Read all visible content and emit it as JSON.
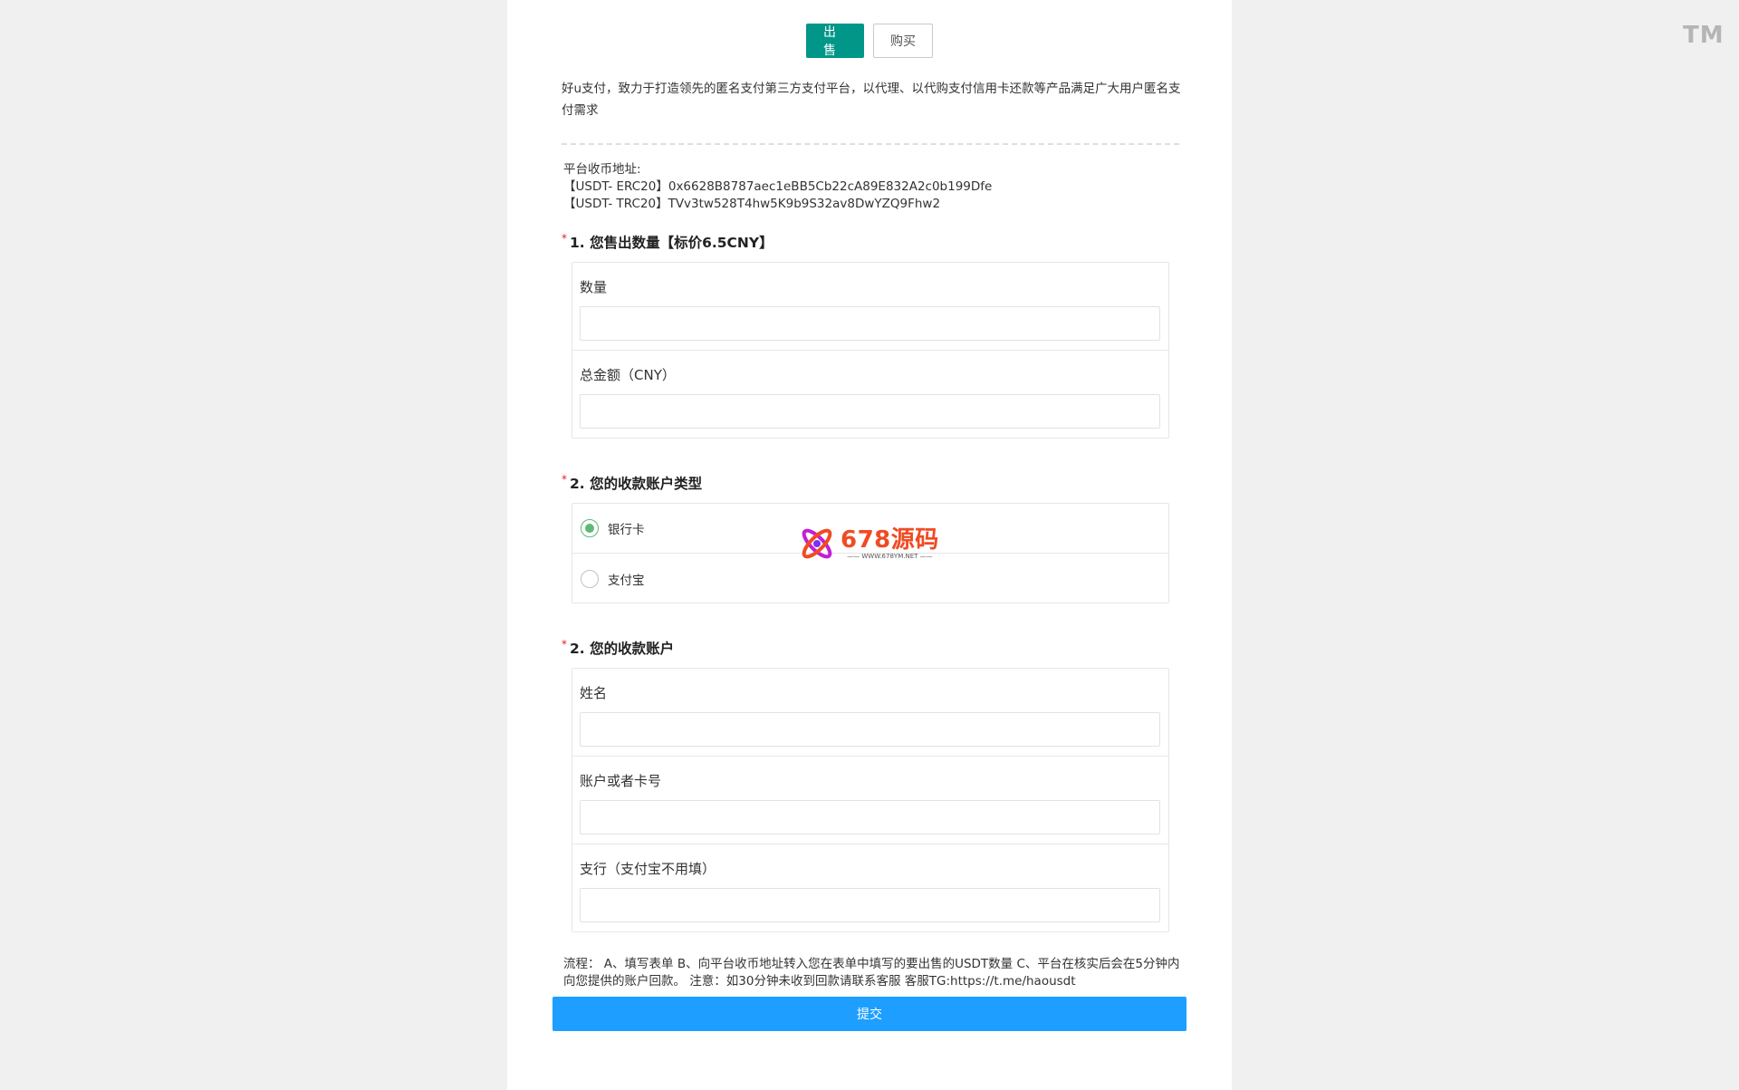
{
  "corner_mark": "TM",
  "tabs": {
    "sell_label": "出售",
    "buy_label": "购买"
  },
  "intro_text": "好u支付，致力于打造领先的匿名支付第三方支付平台，以代理、以代购支付信用卡还款等产品满足广大用户匿名支付需求",
  "address": {
    "heading": "平台收币地址:",
    "erc20": "【USDT- ERC20】0x6628B8787aec1eBB5Cb22cA89E832A2c0b199Dfe",
    "trc20": "【USDT- TRC20】TVv3tw528T4hw5K9b9S32av8DwYZQ9Fhw2"
  },
  "section1": {
    "star": "*",
    "title": "1. 您售出数量【标价6.5CNY】",
    "quantity_label": "数量",
    "quantity_value": "",
    "total_label": "总金额（CNY）",
    "total_value": ""
  },
  "section2": {
    "star": "*",
    "title": "2. 您的收款账户类型",
    "options": [
      {
        "label": "银行卡",
        "checked": true
      },
      {
        "label": "支付宝",
        "checked": false
      }
    ]
  },
  "section3": {
    "star": "*",
    "title": "2. 您的收款账户",
    "name_label": "姓名",
    "name_value": "",
    "account_label": "账户或者卡号",
    "account_value": "",
    "branch_label": "支行（支付宝不用填）",
    "branch_value": ""
  },
  "watermark": {
    "title": "678源码",
    "url": "—— WWW.678YM.NET ——"
  },
  "process_note": "流程： A、填写表单 B、向平台收币地址转入您在表单中填写的要出售的USDT数量 C、平台在核实后会在5分钟内向您提供的账户回款。 注意：如30分钟未收到回款请联系客服 客服TG:https://t.me/haousdt",
  "submit_label": "提交",
  "colors": {
    "sell_tab": "#009688",
    "radio_checked": "#5fb878",
    "submit": "#1e9fff",
    "required_star": "#e02020",
    "watermark_text": "#f04b23"
  }
}
